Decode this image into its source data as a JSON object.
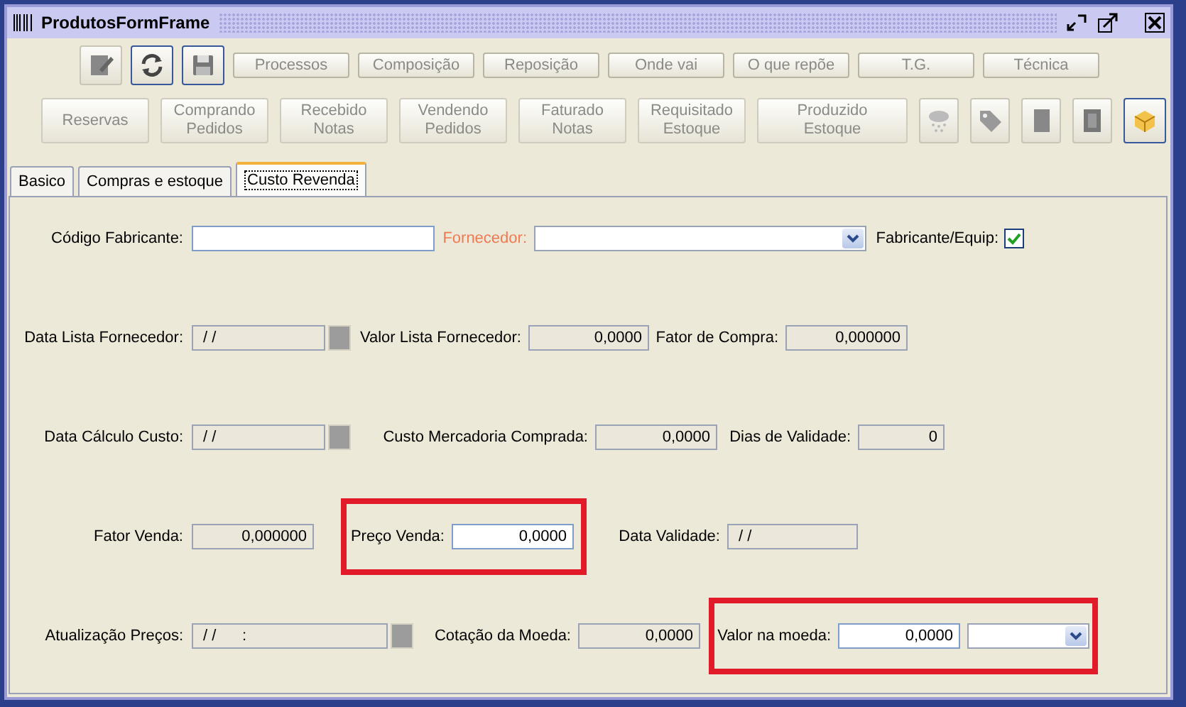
{
  "window": {
    "title": "ProdutosFormFrame"
  },
  "toolbar_top": {
    "icon_buttons": [
      {
        "kind": "edit",
        "disabled": true
      },
      {
        "kind": "refresh",
        "disabled": false
      },
      {
        "kind": "save",
        "disabled": false
      }
    ],
    "buttons": [
      {
        "label": "Processos",
        "disabled": true
      },
      {
        "label": "Composição",
        "disabled": true
      },
      {
        "label": "Reposição",
        "disabled": true
      },
      {
        "label": "Onde vai",
        "disabled": true
      },
      {
        "label": "O que repõe",
        "disabled": true
      },
      {
        "label": "T.G.",
        "disabled": true
      },
      {
        "label": "Técnica",
        "disabled": true
      }
    ]
  },
  "toolbar_bottom": {
    "buttons": [
      {
        "lines": [
          "Reservas"
        ],
        "disabled": true
      },
      {
        "lines": [
          "Comprando",
          "Pedidos"
        ],
        "disabled": true
      },
      {
        "lines": [
          "Recebido",
          "Notas"
        ],
        "disabled": true
      },
      {
        "lines": [
          "Vendendo",
          "Pedidos"
        ],
        "disabled": true
      },
      {
        "lines": [
          "Faturado",
          "Notas"
        ],
        "disabled": true
      },
      {
        "lines": [
          "Requisitado",
          "Estoque"
        ],
        "disabled": true
      },
      {
        "lines": [
          "Produzido",
          "Estoque"
        ],
        "disabled": true
      }
    ],
    "icon_buttons": [
      {
        "kind": "snow",
        "disabled": true
      },
      {
        "kind": "tag",
        "disabled": true
      },
      {
        "kind": "document",
        "disabled": true
      },
      {
        "kind": "film",
        "disabled": true
      },
      {
        "kind": "box",
        "disabled": false
      }
    ]
  },
  "tabs": [
    {
      "label": "Basico",
      "selected": false
    },
    {
      "label": "Compras e estoque",
      "selected": false
    },
    {
      "label": "Custo Revenda",
      "selected": true
    }
  ],
  "form": {
    "rows": [
      {
        "items": [
          {
            "kind": "label",
            "text": "Código Fabricante:"
          },
          {
            "kind": "field",
            "editable": true
          },
          {
            "kind": "label",
            "text": "Fornecedor:",
            "required": true
          },
          {
            "kind": "combo",
            "editable": true
          },
          {
            "kind": "label",
            "text": "Fabricante/Equip:"
          },
          {
            "kind": "checkbox",
            "checked": true
          }
        ]
      },
      {
        "items": [
          {
            "kind": "label",
            "text": "Data Lista Fornecedor:"
          },
          {
            "kind": "field",
            "value": " / /",
            "editable": false
          },
          {
            "kind": "calendar"
          },
          {
            "kind": "label",
            "text": "Valor Lista Fornecedor:"
          },
          {
            "kind": "field",
            "value": "0,0000",
            "editable": false,
            "numeric": true
          },
          {
            "kind": "label",
            "text": "Fator de Compra:"
          },
          {
            "kind": "field",
            "value": "0,000000",
            "editable": false,
            "numeric": true
          }
        ]
      },
      {
        "items": [
          {
            "kind": "label",
            "text": "Data Cálculo Custo:"
          },
          {
            "kind": "field",
            "value": " / /",
            "editable": false
          },
          {
            "kind": "calendar"
          },
          {
            "kind": "label",
            "text": "Custo Mercadoria Comprada:"
          },
          {
            "kind": "field",
            "value": "0,0000",
            "editable": false,
            "numeric": true
          },
          {
            "kind": "label",
            "text": "Dias de Validade:"
          },
          {
            "kind": "field",
            "value": "0",
            "editable": false,
            "numeric": true
          }
        ]
      },
      {
        "items": [
          {
            "kind": "label",
            "text": "Fator Venda:"
          },
          {
            "kind": "field",
            "value": "0,000000",
            "editable": false,
            "numeric": true
          },
          {
            "kind": "group",
            "highlighted": true,
            "items": [
              {
                "kind": "label",
                "text": "Preço Venda:"
              },
              {
                "kind": "field",
                "value": "0,0000",
                "editable": true,
                "numeric": true
              }
            ]
          },
          {
            "kind": "label",
            "text": "Data Validade:"
          },
          {
            "kind": "field",
            "value": " / /",
            "editable": false
          }
        ]
      },
      {
        "items": [
          {
            "kind": "label",
            "text": "Atualização Preços:"
          },
          {
            "kind": "field",
            "value": " / /      :",
            "editable": false
          },
          {
            "kind": "calendar"
          },
          {
            "kind": "label",
            "text": "Cotação da Moeda:"
          },
          {
            "kind": "field",
            "value": "0,0000",
            "editable": false,
            "numeric": true
          },
          {
            "kind": "group",
            "highlighted": true,
            "items": [
              {
                "kind": "label",
                "text": "Valor na moeda:"
              },
              {
                "kind": "field",
                "value": "0,0000",
                "editable": true,
                "numeric": true
              },
              {
                "kind": "combo",
                "editable": true
              }
            ]
          }
        ]
      }
    ]
  }
}
